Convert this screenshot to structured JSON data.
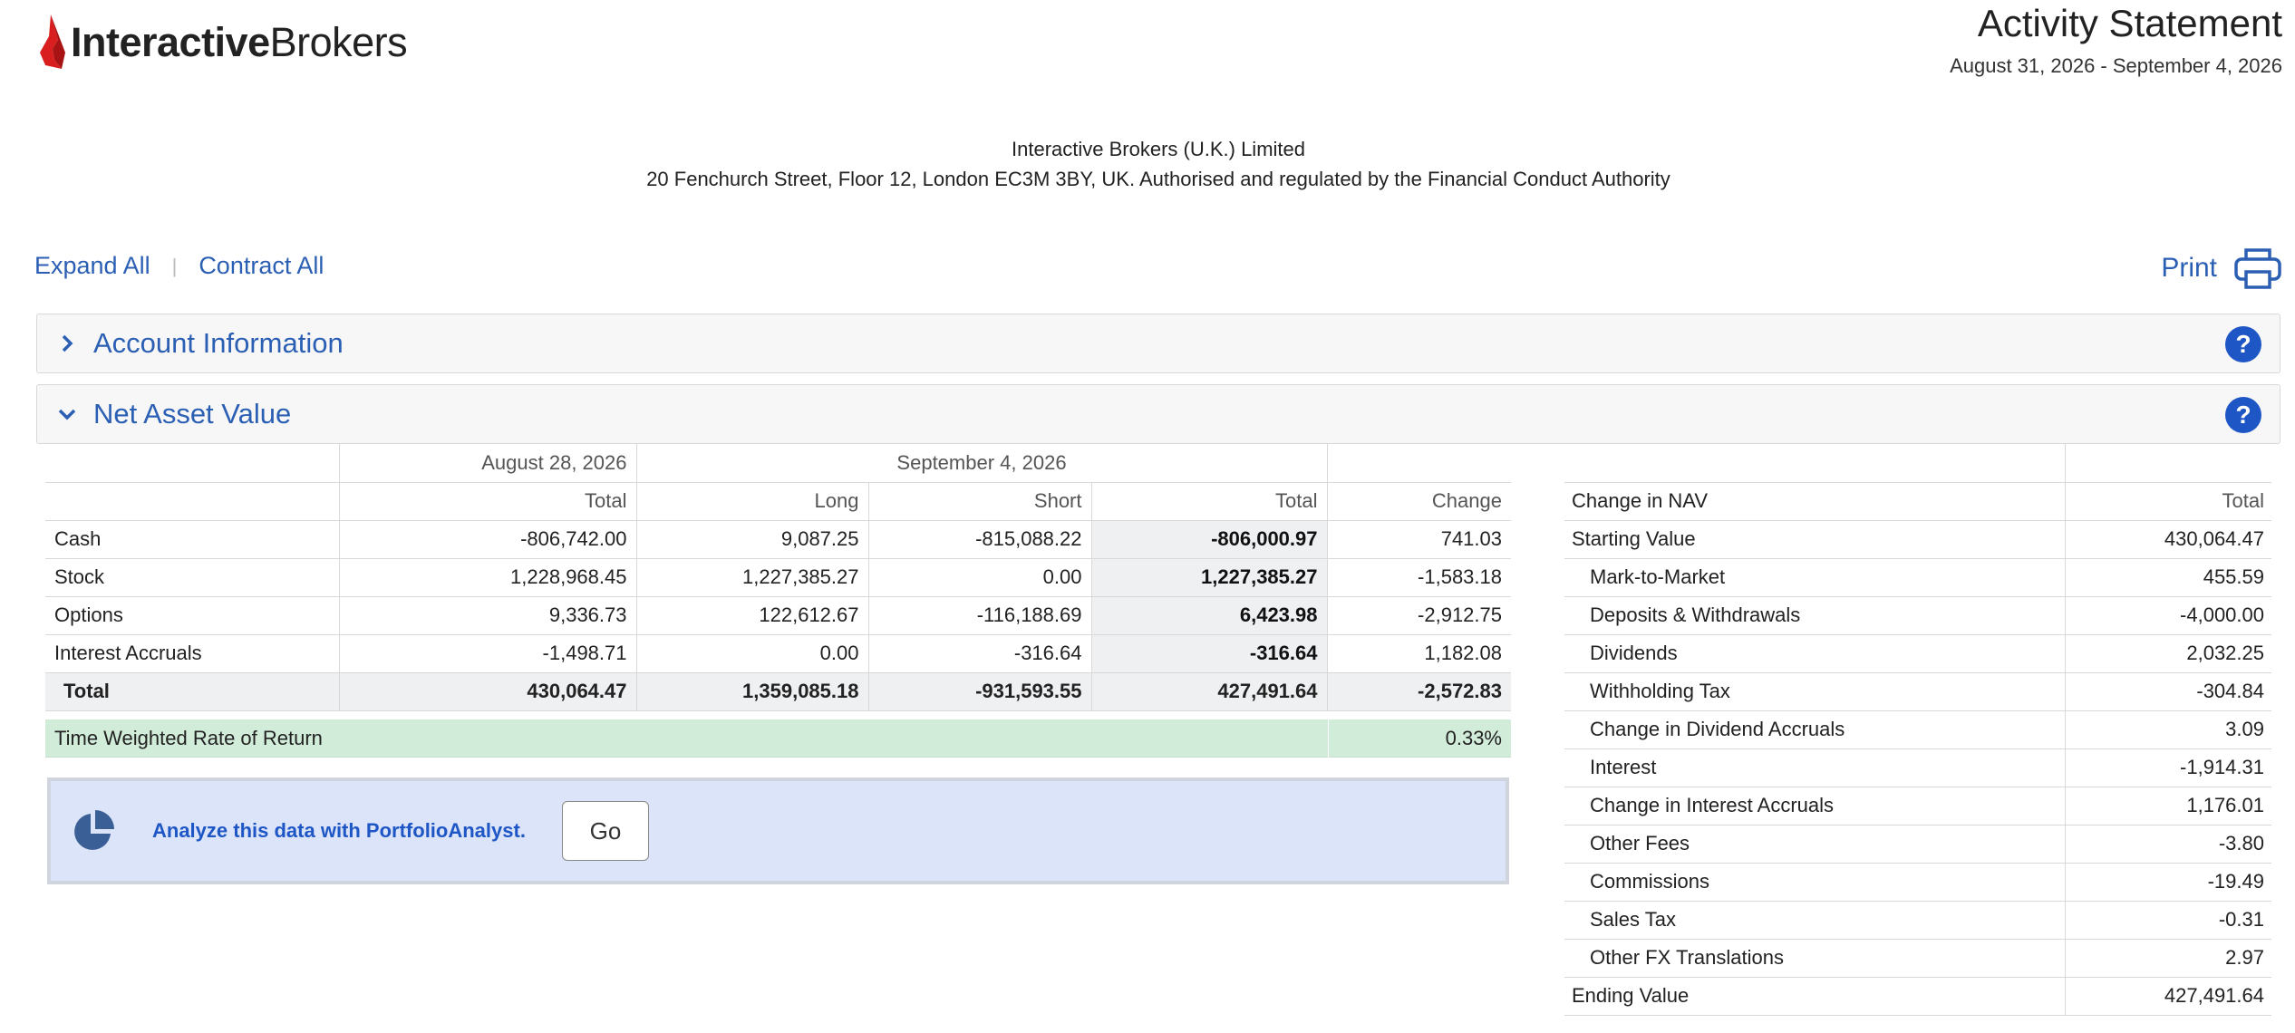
{
  "brand": {
    "name_bold": "Interactive",
    "name_regular": "Brokers"
  },
  "header": {
    "title": "Activity Statement",
    "dates": "August 31, 2026 - September 4, 2026"
  },
  "firm": {
    "name": "Interactive Brokers (U.K.) Limited",
    "address": "20 Fenchurch Street, Floor 12, London EC3M 3BY, UK. Authorised and regulated by the Financial Conduct Authority"
  },
  "controls": {
    "expand_all": "Expand All",
    "separator": "|",
    "contract_all": "Contract All",
    "print": "Print"
  },
  "sections": {
    "account_information": "Account Information",
    "net_asset_value": "Net Asset Value",
    "help": "?"
  },
  "nav": {
    "header_row1": {
      "prior": "August 28, 2026",
      "current": "September 4, 2026"
    },
    "columns": [
      "",
      "Total",
      "Long",
      "Short",
      "Total",
      "Change"
    ],
    "rows": [
      {
        "label": "Cash",
        "prior_total": "-806,742.00",
        "long": "9,087.25",
        "short": "-815,088.22",
        "total": "-806,000.97",
        "change": "741.03"
      },
      {
        "label": "Stock",
        "prior_total": "1,228,968.45",
        "long": "1,227,385.27",
        "short": "0.00",
        "total": "1,227,385.27",
        "change": "-1,583.18"
      },
      {
        "label": "Options",
        "prior_total": "9,336.73",
        "long": "122,612.67",
        "short": "-116,188.69",
        "total": "6,423.98",
        "change": "-2,912.75"
      },
      {
        "label": "Interest Accruals",
        "prior_total": "-1,498.71",
        "long": "0.00",
        "short": "-316.64",
        "total": "-316.64",
        "change": "1,182.08"
      }
    ],
    "total": {
      "label": "Total",
      "prior_total": "430,064.47",
      "long": "1,359,085.18",
      "short": "-931,593.55",
      "total": "427,491.64",
      "change": "-2,572.83"
    },
    "twr": {
      "label": "Time Weighted Rate of Return",
      "value": "0.33%"
    }
  },
  "portfolio_analyst": {
    "text": "Analyze this data with PortfolioAnalyst.",
    "go": "Go"
  },
  "change_in_nav": {
    "header": {
      "label": "Change in NAV",
      "total": "Total"
    },
    "rows": [
      {
        "label": "Starting Value",
        "value": "430,064.47",
        "indent": false
      },
      {
        "label": "Mark-to-Market",
        "value": "455.59",
        "indent": true
      },
      {
        "label": "Deposits & Withdrawals",
        "value": "-4,000.00",
        "indent": true
      },
      {
        "label": "Dividends",
        "value": "2,032.25",
        "indent": true
      },
      {
        "label": "Withholding Tax",
        "value": "-304.84",
        "indent": true
      },
      {
        "label": "Change in Dividend Accruals",
        "value": "3.09",
        "indent": true
      },
      {
        "label": "Interest",
        "value": "-1,914.31",
        "indent": true
      },
      {
        "label": "Change in Interest Accruals",
        "value": "1,176.01",
        "indent": true
      },
      {
        "label": "Other Fees",
        "value": "-3.80",
        "indent": true
      },
      {
        "label": "Commissions",
        "value": "-19.49",
        "indent": true
      },
      {
        "label": "Sales Tax",
        "value": "-0.31",
        "indent": true
      },
      {
        "label": "Other FX Translations",
        "value": "2.97",
        "indent": true
      },
      {
        "label": "Ending Value",
        "value": "427,491.64",
        "indent": false
      }
    ]
  },
  "colors": {
    "link": "#2b5fb4",
    "brand_red": "#d81e1e",
    "help_blue": "#1e56c6",
    "twr_green": "#d2ecda",
    "pa_blue": "#dbe4f8"
  }
}
